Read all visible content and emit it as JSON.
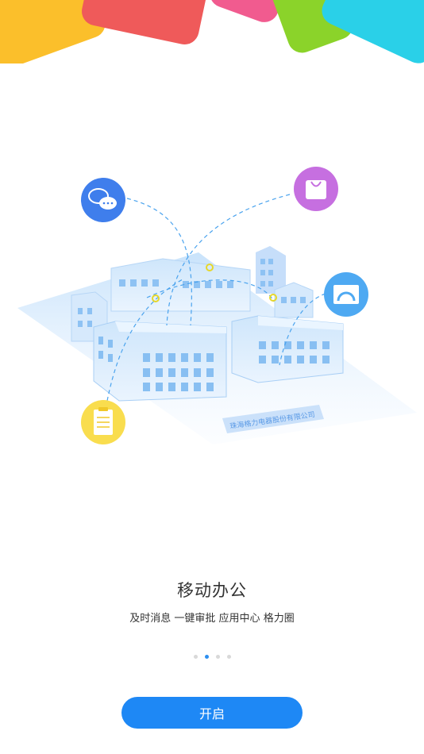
{
  "decor": {
    "colors": [
      "#fbbf2b",
      "#ef5a5a",
      "#f15b8f",
      "#8bd32a",
      "#2ad0e8"
    ]
  },
  "illustration": {
    "company_label": "珠海格力电器股份有限公司",
    "icons": [
      "chat-bubble-icon",
      "shopping-bag-icon",
      "dashboard-icon",
      "clipboard-icon"
    ]
  },
  "title": "移动办公",
  "subtitle": "及时消息 一键审批 应用中心 格力圈",
  "pager": {
    "count": 4,
    "active_index": 1
  },
  "start_button": {
    "label": "开启",
    "color": "#1e88f5"
  }
}
